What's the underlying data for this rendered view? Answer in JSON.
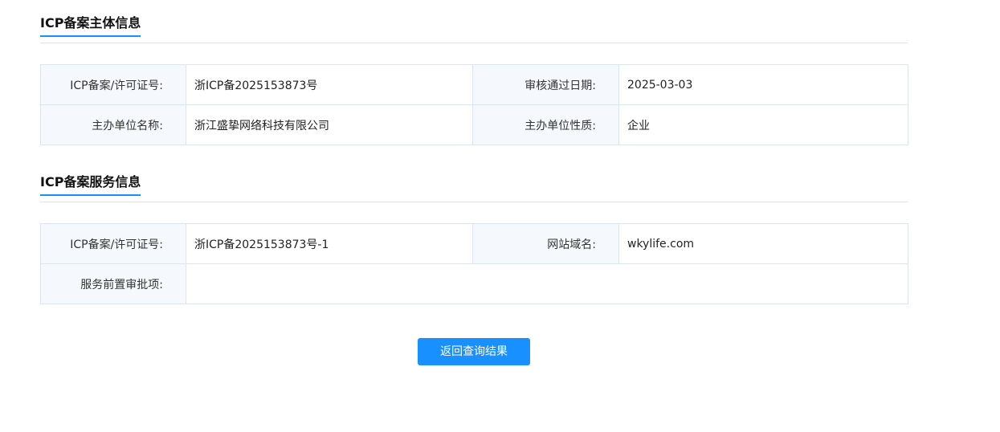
{
  "subject_section": {
    "title": "ICP备案主体信息",
    "rows": [
      {
        "label1": "ICP备案/许可证号:",
        "value1": "浙ICP备2025153873号",
        "label2": "审核通过日期:",
        "value2": "2025-03-03"
      },
      {
        "label1": "主办单位名称:",
        "value1": "浙江盛挚网络科技有限公司",
        "label2": "主办单位性质:",
        "value2": "企业"
      }
    ]
  },
  "service_section": {
    "title": "ICP备案服务信息",
    "rows": [
      {
        "label1": "ICP备案/许可证号:",
        "value1": "浙ICP备2025153873号-1",
        "label2": "网站域名:",
        "value2": "wkylife.com"
      },
      {
        "label1": "服务前置审批项:",
        "value1": ""
      }
    ]
  },
  "back_button_label": "返回查询结果"
}
